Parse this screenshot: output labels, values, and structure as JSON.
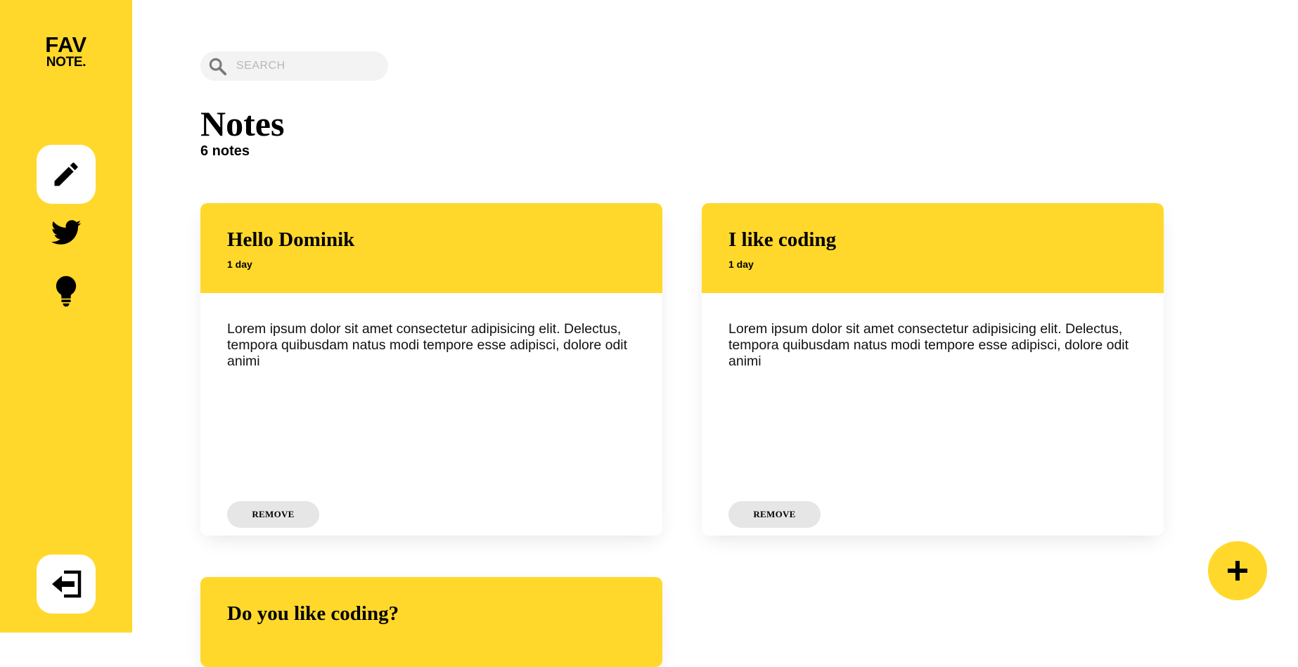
{
  "brand": {
    "logo_line1": "FAV",
    "logo_line2": "NOTE.",
    "accent_color": "#ffd82b"
  },
  "sidebar": {
    "items": [
      {
        "icon": "pencil-icon",
        "active": true
      },
      {
        "icon": "twitter-icon",
        "active": false
      },
      {
        "icon": "lightbulb-icon",
        "active": false
      }
    ],
    "logout_icon": "logout-icon"
  },
  "search": {
    "placeholder": "SEARCH",
    "value": ""
  },
  "header": {
    "title": "Notes",
    "count": "6 notes"
  },
  "cards": [
    {
      "title": "Hello Dominik",
      "date": "1 day",
      "text": "Lorem ipsum dolor sit amet consectetur adipisicing elit. Delectus, tempora quibusdam natus modi tempore esse adipisci, dolore odit animi",
      "remove_label": "REMOVE"
    },
    {
      "title": "I like coding",
      "date": "1 day",
      "text": "Lorem ipsum dolor sit amet consectetur adipisicing elit. Delectus, tempora quibusdam natus modi tempore esse adipisci, dolore odit animi",
      "remove_label": "REMOVE"
    },
    {
      "title": "Do you like coding?"
    }
  ],
  "fab": {
    "icon": "plus-icon"
  }
}
